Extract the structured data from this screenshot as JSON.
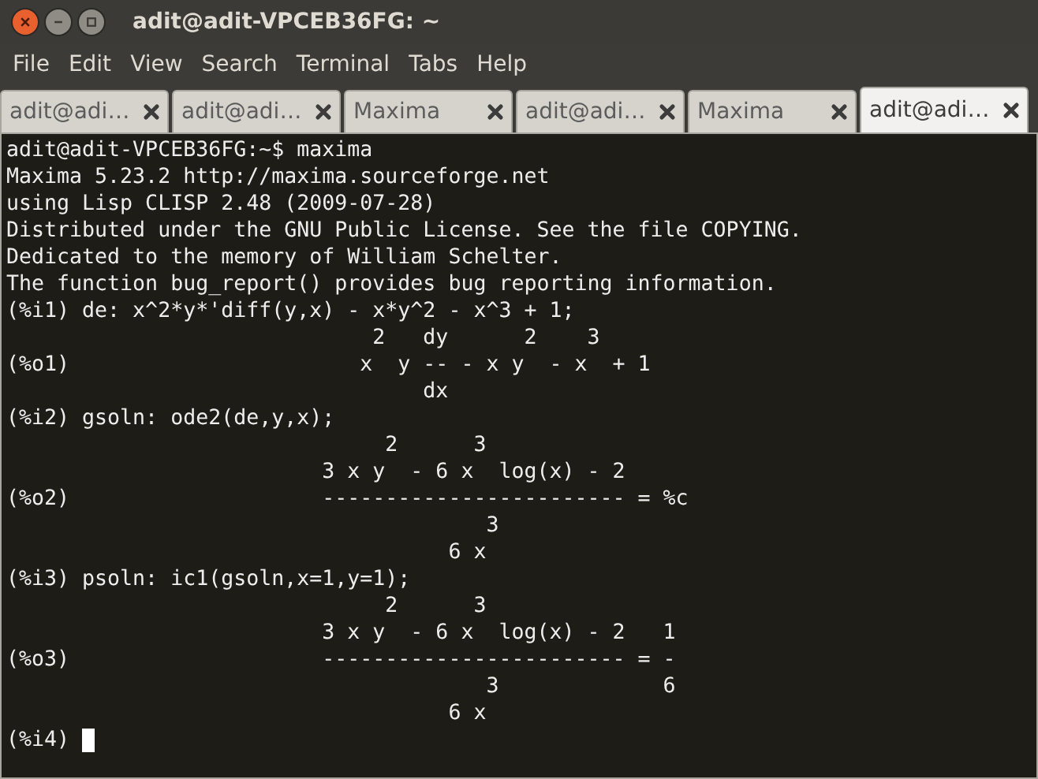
{
  "window": {
    "title": "adit@adit-VPCEB36FG: ~"
  },
  "menu": [
    "File",
    "Edit",
    "View",
    "Search",
    "Terminal",
    "Tabs",
    "Help"
  ],
  "tabs": [
    {
      "label": "adit@adi…",
      "selected": false
    },
    {
      "label": "adit@adi…",
      "selected": false
    },
    {
      "label": "Maxima",
      "selected": false
    },
    {
      "label": "adit@adi…",
      "selected": false
    },
    {
      "label": "Maxima",
      "selected": false
    },
    {
      "label": "adit@adi…",
      "selected": true
    }
  ],
  "terminal": {
    "lines": [
      "adit@adit-VPCEB36FG:~$ maxima",
      "Maxima 5.23.2 http://maxima.sourceforge.net",
      "using Lisp CLISP 2.48 (2009-07-28)",
      "Distributed under the GNU Public License. See the file COPYING.",
      "Dedicated to the memory of William Schelter.",
      "The function bug_report() provides bug reporting information.",
      "(%i1) de: x^2*y*'diff(y,x) - x*y^2 - x^3 + 1;",
      "                             2   dy      2    3",
      "(%o1)                       x  y -- - x y  - x  + 1",
      "                                 dx",
      "(%i2) gsoln: ode2(de,y,x);",
      "                              2      3",
      "                         3 x y  - 6 x  log(x) - 2",
      "(%o2)                    ------------------------ = %c",
      "                                      3",
      "                                   6 x",
      "(%i3) psoln: ic1(gsoln,x=1,y=1);",
      "                              2      3",
      "                         3 x y  - 6 x  log(x) - 2   1",
      "(%o3)                    ------------------------ = -",
      "                                      3             6",
      "                                   6 x",
      "(%i4) "
    ],
    "cursor": true
  }
}
